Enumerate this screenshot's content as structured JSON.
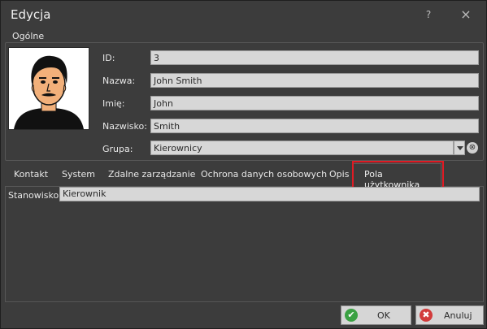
{
  "window": {
    "title": "Edycja",
    "help_icon": "?",
    "close_icon": "×"
  },
  "general": {
    "group_label": "Ogólne",
    "fields": {
      "id": {
        "label": "ID:",
        "value": "3"
      },
      "nazwa": {
        "label": "Nazwa:",
        "value": "John Smith"
      },
      "imie": {
        "label": "Imię:",
        "value": "John"
      },
      "nazwisko": {
        "label": "Nazwisko:",
        "value": "Smith"
      },
      "grupa": {
        "label": "Grupa:",
        "value": "Kierownicy"
      }
    }
  },
  "tabs": [
    "Kontakt",
    "System",
    "Zdalne zarządzanie",
    "Ochrona danych osobowych",
    "Opis",
    "Pola użytkownika"
  ],
  "active_tab": "Pola użytkownika",
  "custom_fields": {
    "stanowisko": {
      "label": "Stanowisko:",
      "value": "Kierownik"
    }
  },
  "buttons": {
    "ok": "OK",
    "cancel": "Anuluj"
  },
  "colors": {
    "highlight": "#e01b24",
    "ok_icon": "#3aa142",
    "cancel_icon": "#d23b3b"
  }
}
